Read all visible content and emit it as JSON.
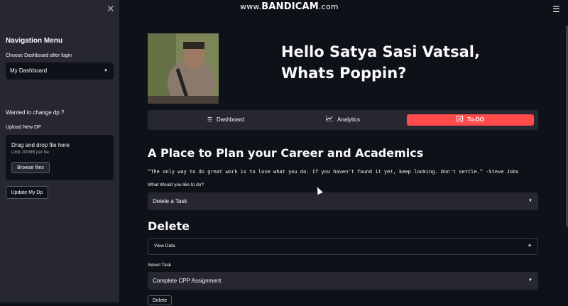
{
  "watermark": {
    "prefix": "www.",
    "brand": "BANDICAM",
    "suffix": ".com"
  },
  "sidebar": {
    "close_icon": "✕",
    "title": "Navigation Menu",
    "dashboard_label": "Choose Dashboard after login",
    "dashboard_value": "My Dashboard",
    "change_dp_heading": "Wanted to change dp ?",
    "upload_label": "Upload New DP",
    "dropzone_title": "Drag and drop file here",
    "dropzone_limit": "Limit 200MB per file",
    "browse_label": "Browse files",
    "update_label": "Update My Dp"
  },
  "header": {
    "greeting": "Hello Satya Sasi Vatsal, Whats Poppin?",
    "menu_icon": "☰"
  },
  "menu": {
    "items": [
      {
        "label": "Dashboard",
        "icon": "list-icon"
      },
      {
        "label": "Analytics",
        "icon": "chart-line-icon"
      },
      {
        "label": "To-DO",
        "icon": "calendar-check-icon"
      }
    ],
    "active": "To-DO",
    "accent": "#ff4b4b"
  },
  "main": {
    "heading": "A Place to Plan your Career and Academics",
    "quote": "“The only way to do great work is to love what you do. If you haven't found it yet, keep looking. Don't settle.” -Steve Jobs",
    "action_label": "What Would you like to do?",
    "action_value": "Delete a Task",
    "section_heading": "Delete",
    "expander_label": "View Data",
    "select_task_label": "Select Task",
    "select_task_value": "Complete CPP Assignment",
    "delete_label": "Delete"
  }
}
